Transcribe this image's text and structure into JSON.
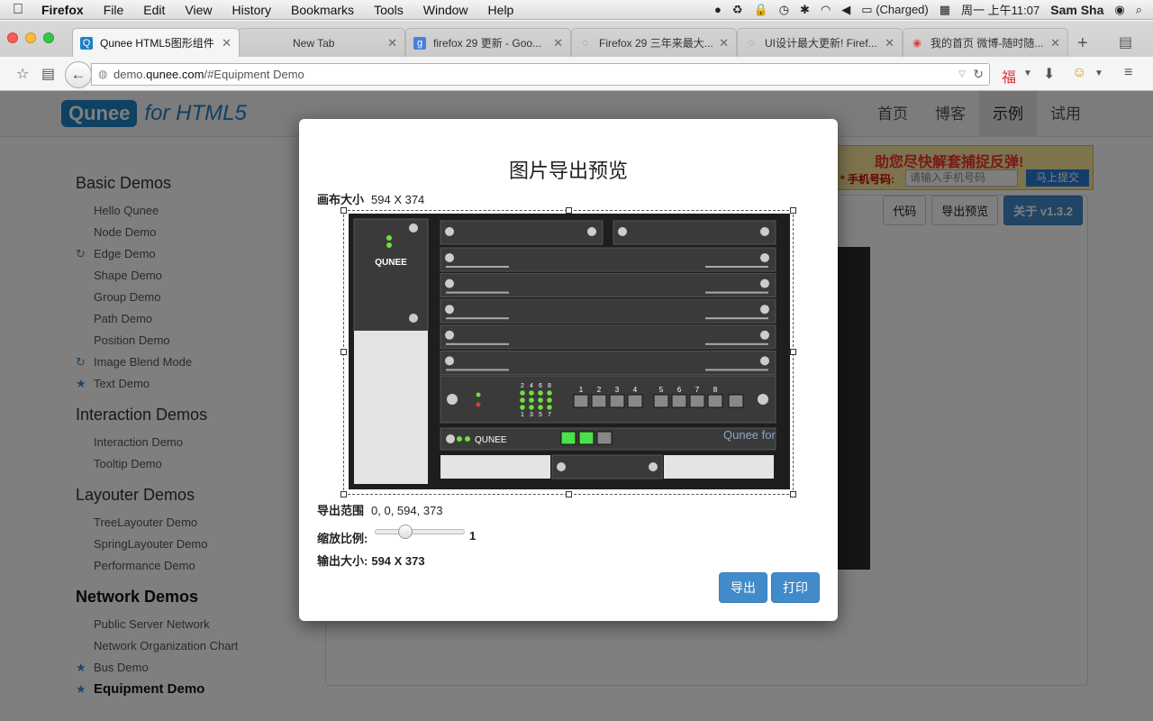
{
  "menubar": {
    "app": "Firefox",
    "items": [
      "File",
      "Edit",
      "View",
      "History",
      "Bookmarks",
      "Tools",
      "Window",
      "Help"
    ],
    "battery": "(Charged)",
    "clock": "周一 上午11:07",
    "user": "Sam Sha"
  },
  "tabs": [
    {
      "title": "Qunee HTML5图形组件 ..."
    },
    {
      "title": "New Tab"
    },
    {
      "title": "firefox 29 更新 - Goo..."
    },
    {
      "title": "Firefox 29 三年来最大..."
    },
    {
      "title": "UI设计最大更新! Firef..."
    },
    {
      "title": "我的首页 微博-随时随..."
    }
  ],
  "url": {
    "prefix": "demo.",
    "host": "qunee.com",
    "path": "/#Equipment Demo"
  },
  "site": {
    "logo_box": "Qunee",
    "logo_rest": "for HTML5",
    "nav": [
      "首页",
      "博客",
      "示例",
      "试用"
    ]
  },
  "sidebar": {
    "groups": [
      {
        "heading": "Basic Demos",
        "items": [
          "Hello Qunee",
          "Node Demo",
          "Edge Demo",
          "Shape Demo",
          "Group Demo",
          "Path Demo",
          "Position Demo",
          "Image Blend Mode",
          "Text Demo"
        ]
      },
      {
        "heading": "Interaction Demos",
        "items": [
          "Interaction Demo",
          "Tooltip Demo"
        ]
      },
      {
        "heading": "Layouter Demos",
        "items": [
          "TreeLayouter Demo",
          "SpringLayouter Demo",
          "Performance Demo"
        ]
      },
      {
        "heading": "Network Demos",
        "items": [
          "Public Server Network",
          "Network Organization Chart",
          "Bus Demo",
          "Equipment Demo"
        ]
      }
    ]
  },
  "toolbar": {
    "code": "代码",
    "export_preview": "导出预览",
    "about": "关于 v1.3.2"
  },
  "ad": {
    "headline": "助您尽快解套捕捉反弹!",
    "phone_label": "* 手机号码:",
    "phone_placeholder": "请输入手机号码",
    "submit": "马上提交"
  },
  "modal": {
    "title": "图片导出预览",
    "canvas_label": "画布大小",
    "canvas_value": "594 X 374",
    "range_label": "导出范围",
    "range_value": "0, 0, 594, 373",
    "scale_label": "缩放比例:",
    "scale_value": "1",
    "scale_fraction": 0.33,
    "output_label": "输出大小:",
    "output_value": "594 X 373",
    "export_button": "导出",
    "print_button": "打印"
  },
  "rack": {
    "brand": "QUNEE",
    "watermark": "Qunee for",
    "port_numbers_top": [
      "2",
      "4",
      "6",
      "8"
    ],
    "port_numbers_bottom": [
      "1",
      "3",
      "5",
      "7"
    ],
    "port_labels": [
      "1",
      "2",
      "3",
      "4",
      "5",
      "6",
      "7",
      "8"
    ]
  }
}
